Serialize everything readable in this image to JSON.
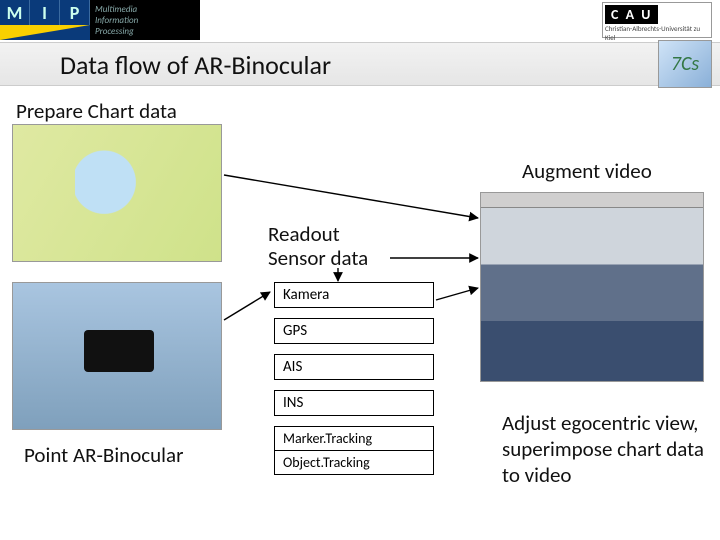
{
  "header": {
    "mip_letters": [
      "M",
      "I",
      "P"
    ],
    "mip_full": "Multimedia\nInformation\nProcessing",
    "cau_abbrev": "C A U",
    "cau_full": "Christian-Albrechts-Universität zu Kiel",
    "badge": "7Cs"
  },
  "title": "Data flow of AR-Binocular",
  "labels": {
    "prepare": "Prepare Chart data",
    "augment": "Augment video",
    "readout_l1": "Readout",
    "readout_l2": "Sensor data",
    "point": "Point AR-Binocular",
    "adjust": "Adjust egocentric view, superimpose chart data to video"
  },
  "sensors": {
    "group1": [
      "Kamera",
      "GPS",
      "AIS",
      "INS"
    ],
    "group2": [
      "Marker.Tracking",
      "Object.Tracking"
    ]
  }
}
